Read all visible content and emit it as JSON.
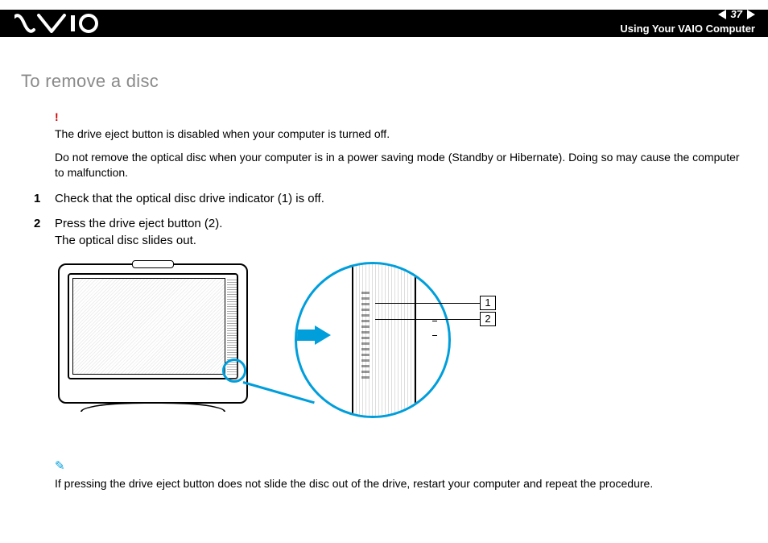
{
  "header": {
    "page_number": "37",
    "section": "Using Your VAIO Computer"
  },
  "heading": "To remove a disc",
  "warning": {
    "mark": "!",
    "line1": "The drive eject button is disabled when your computer is turned off.",
    "line2": "Do not remove the optical disc when your computer is in a power saving mode (Standby or Hibernate). Doing so may cause the computer to malfunction."
  },
  "steps": [
    {
      "n": "1",
      "text": "Check that the optical disc drive indicator (1) is off."
    },
    {
      "n": "2",
      "text": "Press the drive eject button (2).",
      "text2": "The optical disc slides out."
    }
  ],
  "callouts": {
    "one": "1",
    "two": "2"
  },
  "note": {
    "icon": "✎",
    "text": "If pressing the drive eject button does not slide the disc out of the drive, restart your computer and repeat the procedure."
  }
}
